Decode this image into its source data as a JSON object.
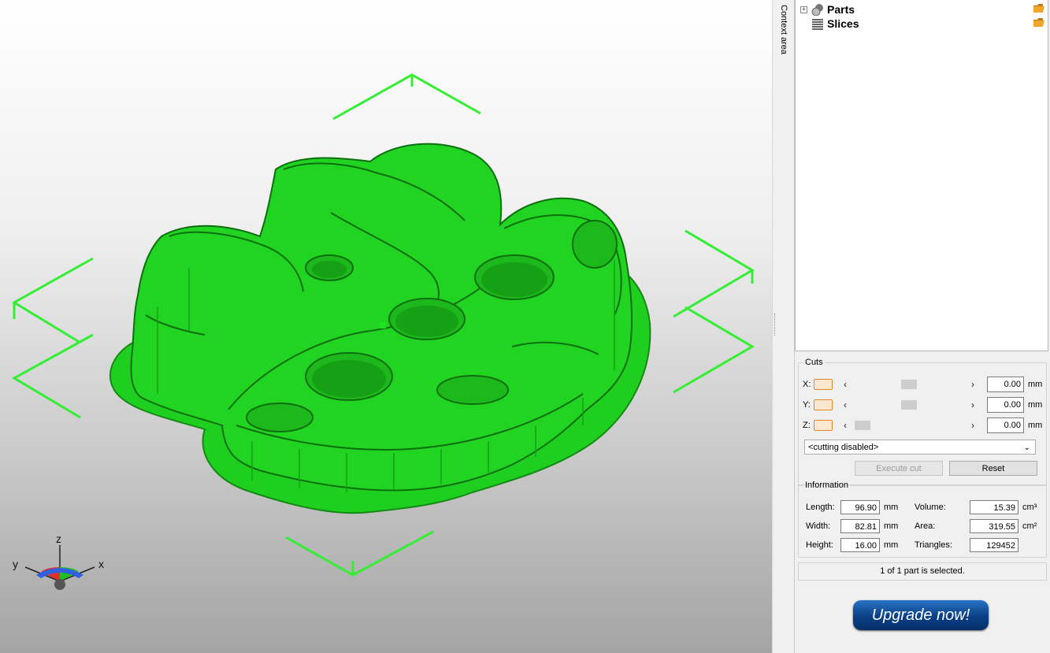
{
  "context_area_label": "Context area",
  "tree": {
    "items": [
      {
        "label": "Parts",
        "icon": "parts-icon",
        "expandable": true
      },
      {
        "label": "Slices",
        "icon": "slices-icon",
        "expandable": false
      }
    ]
  },
  "cuts": {
    "title": "Cuts",
    "axes": [
      {
        "label": "X:",
        "value": "0.00",
        "unit": "mm",
        "slider_fraction": 0.5
      },
      {
        "label": "Y:",
        "value": "0.00",
        "unit": "mm",
        "slider_fraction": 0.5
      },
      {
        "label": "Z:",
        "value": "0.00",
        "unit": "mm",
        "slider_fraction": 0.0
      }
    ],
    "mode_selected": "<cutting disabled>",
    "execute_label": "Execute cut",
    "reset_label": "Reset"
  },
  "information": {
    "title": "Information",
    "length_label": "Length:",
    "length_value": "96.90",
    "length_unit": "mm",
    "width_label": "Width:",
    "width_value": "82.81",
    "width_unit": "mm",
    "height_label": "Height:",
    "height_value": "16.00",
    "height_unit": "mm",
    "volume_label": "Volume:",
    "volume_value": "15.39",
    "volume_unit": "cm³",
    "area_label": "Area:",
    "area_value": "319.55",
    "area_unit": "cm²",
    "triangles_label": "Triangles:",
    "triangles_value": "129452"
  },
  "status_text": "1 of 1 part is selected.",
  "upgrade_label": "Upgrade now!",
  "axis_gizmo": {
    "x": "x",
    "y": "y",
    "z": "z"
  },
  "colors": {
    "model": "#22d422",
    "model_dark": "#1aa81a",
    "bbox": "#33ee33",
    "upgrade": "#0a3f86"
  }
}
